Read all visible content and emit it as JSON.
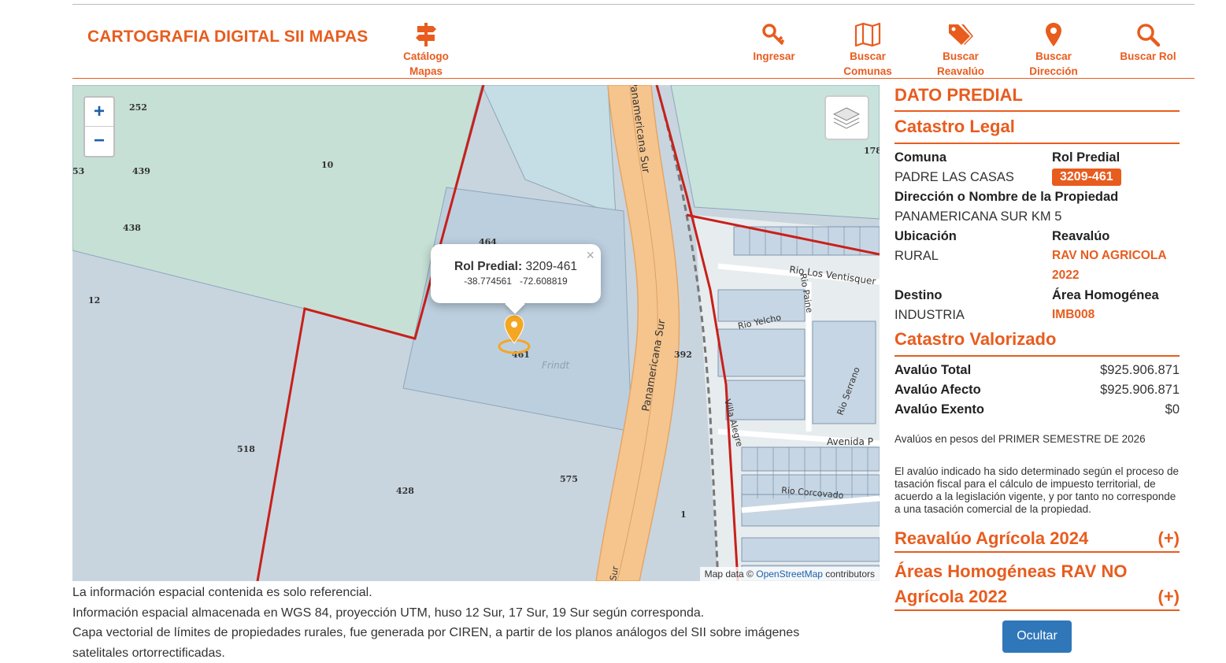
{
  "header": {
    "title": "CARTOGRAFIA DIGITAL SII MAPAS",
    "nav": [
      {
        "label1": "Catálogo",
        "label2": "Mapas",
        "icon": "signpost-icon"
      },
      {
        "label1": "Ingresar",
        "label2": "",
        "icon": "key-icon"
      },
      {
        "label1": "Buscar",
        "label2": "Comunas",
        "icon": "map-icon"
      },
      {
        "label1": "Buscar",
        "label2": "Reavalúo",
        "icon": "tags-icon"
      },
      {
        "label1": "Buscar",
        "label2": "Dirección",
        "icon": "map-pin-icon"
      },
      {
        "label1": "Buscar Rol",
        "label2": "",
        "icon": "search-icon"
      }
    ]
  },
  "map": {
    "zoom_in": "+",
    "zoom_out": "−",
    "popup": {
      "title_label": "Rol Predial:",
      "title_value": "3209-461",
      "lat": "-38.774561",
      "lon": "-72.608819",
      "close": "×"
    },
    "parcels": [
      "252",
      "439",
      "438",
      "10",
      "12",
      "464",
      "461",
      "392",
      "518",
      "428",
      "575",
      "1",
      "53",
      "178"
    ],
    "streets": [
      "Panamericana Sur",
      "Panamericana Sur",
      "Rio Los Ventisquer",
      "Rio Paine",
      "Rio Yelcho",
      "Villa Alegre",
      "Avenida P",
      "Rio Corcovado",
      "Rio Serrano",
      "Frindt",
      "Sur"
    ],
    "attribution_prefix": "Map data ©",
    "attribution_link": "OpenStreetMap",
    "attribution_suffix": "contributors"
  },
  "footnotes": [
    "La información espacial contenida es solo referencial.",
    "Información espacial almacenada en WGS 84, proyección UTM, huso 12 Sur, 17 Sur, 19 Sur según corresponda.",
    "Capa vectorial de límites de propiedades rurales, fue generada por CIREN, a partir de los planos análogos del SII sobre imágenes",
    "satelitales ortorrectificadas."
  ],
  "panel": {
    "title": "DATO PREDIAL",
    "legal_title": "Catastro Legal",
    "comuna_label": "Comuna",
    "comuna_value": "PADRE LAS CASAS",
    "rol_label": "Rol Predial",
    "rol_value": "3209-461",
    "direccion_label": "Dirección o Nombre de la Propiedad",
    "direccion_value": "PANAMERICANA SUR KM 5",
    "ubicacion_label": "Ubicación",
    "ubicacion_value": "RURAL",
    "reavaluo_label": "Reavalúo",
    "reavaluo_value1": "RAV NO AGRICOLA",
    "reavaluo_value2": "2022",
    "destino_label": "Destino",
    "destino_value": "INDUSTRIA",
    "area_label": "Área Homogénea",
    "area_value": "IMB008",
    "valorizado_title": "Catastro Valorizado",
    "avaluo_total_label": "Avalúo Total",
    "avaluo_total_value": "$925.906.871",
    "avaluo_afecto_label": "Avalúo Afecto",
    "avaluo_afecto_value": "$925.906.871",
    "avaluo_exento_label": "Avalúo Exento",
    "avaluo_exento_value": "$0",
    "semester_note": "Avalúos en pesos del PRIMER SEMESTRE DE 2026",
    "disclaimer": "El avalúo indicado ha sido determinado según el proceso de tasación fiscal para el cálculo de impuesto territorial, de acuerdo a la legislación vigente, y por tanto no corresponde a una tasación comercial de la propiedad.",
    "rav_agricola": "Reavalúo Agrícola 2024",
    "areas_homog_1": "Áreas Homogéneas RAV NO",
    "areas_homog_2": "Agrícola 2022",
    "expand": "(+)",
    "hide_button": "Ocultar"
  },
  "colors": {
    "accent": "#e85c1e",
    "button": "#2f77b9",
    "parcel_border": "#c8201a",
    "road": "#f6c58e"
  }
}
